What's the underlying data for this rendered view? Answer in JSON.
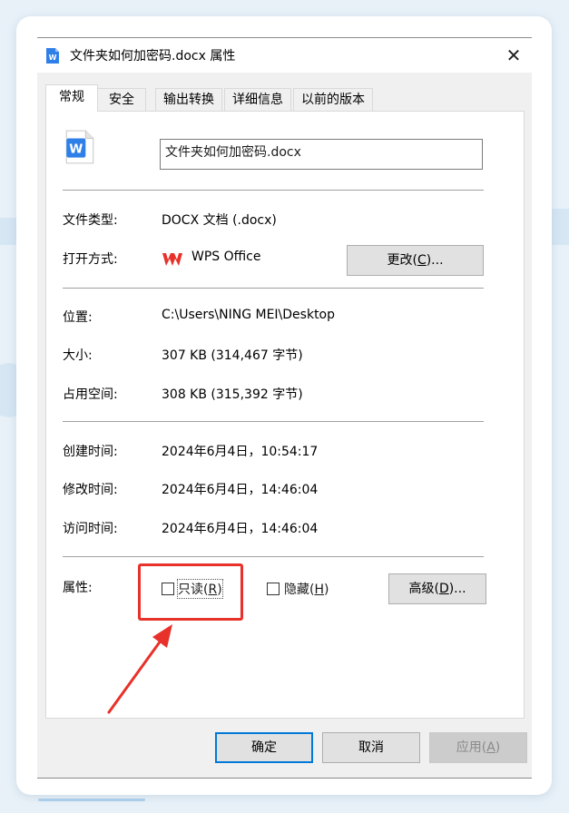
{
  "dialog": {
    "title": "文件夹如何加密码.docx 属性",
    "close_glyph": "✕"
  },
  "tabs": [
    "常规",
    "安全",
    "输出转换",
    "详细信息",
    "以前的版本"
  ],
  "general": {
    "file_name": "文件夹如何加密码.docx",
    "file_type_label": "文件类型:",
    "file_type_value": "DOCX 文档 (.docx)",
    "open_with_label": "打开方式:",
    "open_with_value": "WPS Office",
    "change_button": "更改(",
    "change_button_key": "C",
    "change_button_suffix": ")...",
    "location_label": "位置:",
    "location_value": "C:\\Users\\NING MEI\\Desktop",
    "size_label": "大小:",
    "size_value": "307 KB (314,467 字节)",
    "disk_size_label": "占用空间:",
    "disk_size_value": "308 KB (315,392 字节)",
    "created_label": "创建时间:",
    "created_value": "2024年6月4日，10:54:17",
    "modified_label": "修改时间:",
    "modified_value": "2024年6月4日，14:46:04",
    "accessed_label": "访问时间:",
    "accessed_value": "2024年6月4日，14:46:04",
    "attributes_label": "属性:",
    "readonly_label": "只读(",
    "readonly_key": "R",
    "readonly_suffix": ")",
    "readonly_checked": false,
    "hidden_label": "隐藏(",
    "hidden_key": "H",
    "hidden_suffix": ")",
    "hidden_checked": false,
    "advanced_button": "高级(",
    "advanced_button_key": "D",
    "advanced_button_suffix": ")..."
  },
  "footer": {
    "ok_button": "确定",
    "cancel_button": "取消",
    "apply_button": "应用(",
    "apply_button_key": "A",
    "apply_button_suffix": ")"
  },
  "icons": {
    "title_icon": "wps-document-icon",
    "file_icon": "wps-document-icon",
    "app_icon": "wps-office-logo"
  },
  "colors": {
    "wps_blue": "#2f7fe8",
    "wps_red": "#e8312a",
    "highlight": "#e8312a",
    "ok_border": "#0078d7"
  }
}
